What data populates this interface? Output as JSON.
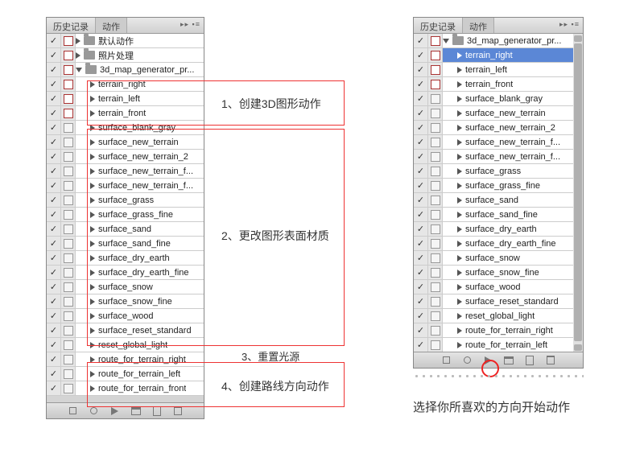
{
  "tabs": {
    "history": "历史记录",
    "actions": "动作"
  },
  "left_panel": {
    "rootFolders": [
      {
        "name": "默认动作",
        "check": true,
        "red": true
      },
      {
        "name": "照片处理",
        "check": true,
        "red": true
      }
    ],
    "mainFolder": {
      "name": "3d_map_generator_pr...",
      "check": true,
      "red": true,
      "expanded": true
    },
    "actions": [
      {
        "name": "terrain_right",
        "check": true,
        "red": true
      },
      {
        "name": "terrain_left",
        "check": true,
        "red": true
      },
      {
        "name": "terrain_front",
        "check": true,
        "red": true
      },
      {
        "name": "surface_blank_gray",
        "check": true,
        "red": false
      },
      {
        "name": "surface_new_terrain",
        "check": true,
        "red": false
      },
      {
        "name": "surface_new_terrain_2",
        "check": true,
        "red": false
      },
      {
        "name": "surface_new_terrain_f...",
        "check": true,
        "red": false
      },
      {
        "name": "surface_new_terrain_f...",
        "check": true,
        "red": false
      },
      {
        "name": "surface_grass",
        "check": true,
        "red": false
      },
      {
        "name": "surface_grass_fine",
        "check": true,
        "red": false
      },
      {
        "name": "surface_sand",
        "check": true,
        "red": false
      },
      {
        "name": "surface_sand_fine",
        "check": true,
        "red": false
      },
      {
        "name": "surface_dry_earth",
        "check": true,
        "red": false
      },
      {
        "name": "surface_dry_earth_fine",
        "check": true,
        "red": false
      },
      {
        "name": "surface_snow",
        "check": true,
        "red": false
      },
      {
        "name": "surface_snow_fine",
        "check": true,
        "red": false
      },
      {
        "name": "surface_wood",
        "check": true,
        "red": false
      },
      {
        "name": "surface_reset_standard",
        "check": true,
        "red": false
      },
      {
        "name": "reset_global_light",
        "check": true,
        "red": false
      },
      {
        "name": "route_for_terrain_right",
        "check": true,
        "red": false
      },
      {
        "name": "route_for_terrain_left",
        "check": true,
        "red": false
      },
      {
        "name": "route_for_terrain_front",
        "check": true,
        "red": false
      }
    ]
  },
  "right_panel": {
    "mainFolder": {
      "name": "3d_map_generator_pr...",
      "check": true,
      "red": true,
      "expanded": true
    },
    "actions": [
      {
        "name": "terrain_right",
        "check": true,
        "red": true,
        "selected": true
      },
      {
        "name": "terrain_left",
        "check": true,
        "red": true
      },
      {
        "name": "terrain_front",
        "check": true,
        "red": true
      },
      {
        "name": "surface_blank_gray",
        "check": true,
        "red": false
      },
      {
        "name": "surface_new_terrain",
        "check": true,
        "red": false
      },
      {
        "name": "surface_new_terrain_2",
        "check": true,
        "red": false
      },
      {
        "name": "surface_new_terrain_f...",
        "check": true,
        "red": false
      },
      {
        "name": "surface_new_terrain_f...",
        "check": true,
        "red": false
      },
      {
        "name": "surface_grass",
        "check": true,
        "red": false
      },
      {
        "name": "surface_grass_fine",
        "check": true,
        "red": false
      },
      {
        "name": "surface_sand",
        "check": true,
        "red": false
      },
      {
        "name": "surface_sand_fine",
        "check": true,
        "red": false
      },
      {
        "name": "surface_dry_earth",
        "check": true,
        "red": false
      },
      {
        "name": "surface_dry_earth_fine",
        "check": true,
        "red": false
      },
      {
        "name": "surface_snow",
        "check": true,
        "red": false
      },
      {
        "name": "surface_snow_fine",
        "check": true,
        "red": false
      },
      {
        "name": "surface_wood",
        "check": true,
        "red": false
      },
      {
        "name": "surface_reset_standard",
        "check": true,
        "red": false
      },
      {
        "name": "reset_global_light",
        "check": true,
        "red": false
      },
      {
        "name": "route_for_terrain_right",
        "check": true,
        "red": false
      },
      {
        "name": "route_for_terrain_left",
        "check": true,
        "red": false
      }
    ]
  },
  "annotations": {
    "a1": "1、创建3D图形动作",
    "a2": "2、更改图形表面材质",
    "a3": "3、重置光源",
    "a4": "4、创建路线方向动作"
  },
  "caption": "选择你所喜欢的方向开始动作"
}
